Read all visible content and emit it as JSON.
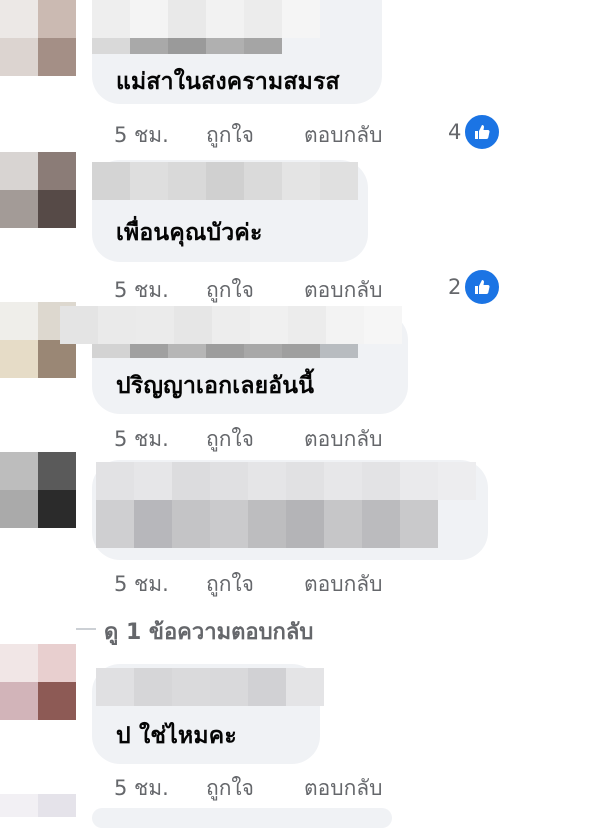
{
  "comments": [
    {
      "text": "แม่สาในสงครามสมรส",
      "time": "5 ชม.",
      "like": "ถูกใจ",
      "reply": "ตอบกลับ",
      "reactions": "4"
    },
    {
      "text": "เพื่อนคุณบัวค่ะ",
      "time": "5 ชม.",
      "like": "ถูกใจ",
      "reply": "ตอบกลับ",
      "reactions": "2"
    },
    {
      "text": "ปริญญาเอกเลยอันนี้",
      "time": "5 ชม.",
      "like": "ถูกใจ",
      "reply": "ตอบกลับ"
    },
    {
      "text": "",
      "time": "5 ชม.",
      "like": "ถูกใจ",
      "reply": "ตอบกลับ"
    },
    {
      "text": "ป ใช่ไหมคะ",
      "time": "5 ชม.",
      "like": "ถูกใจ",
      "reply": "ตอบกลับ"
    }
  ],
  "view_replies": "ดู 1 ข้อความตอบกลับ",
  "colors": {
    "like_blue": "#1b74e4",
    "meta_gray": "#65676b",
    "bubble_bg": "#f0f2f5"
  },
  "icons": {
    "reaction": "like-thumbs-up-icon"
  }
}
